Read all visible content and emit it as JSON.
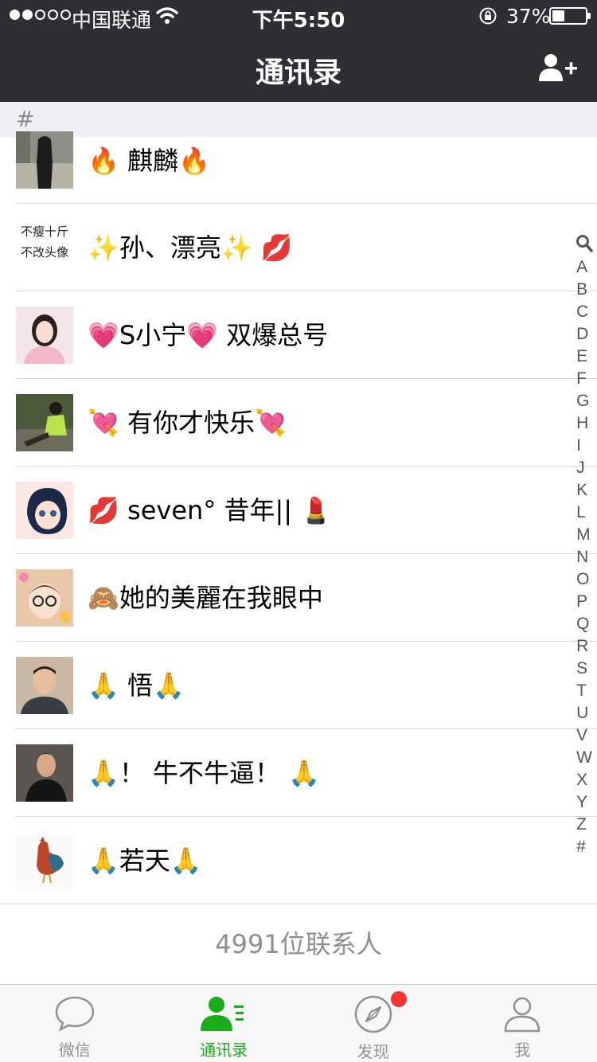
{
  "status": {
    "carrier": "中国联通",
    "time": "下午5:50",
    "battery": "37%",
    "battery_level": 0.37
  },
  "nav": {
    "title": "通讯录"
  },
  "section": {
    "letter": "#"
  },
  "contacts": [
    {
      "name": "🔥 麒麟🔥"
    },
    {
      "name": "✨孙、漂亮✨ 💋",
      "avatar_text": [
        "不瘦十斤",
        "不改头像"
      ]
    },
    {
      "name": "💗S小宁💗 双爆总号"
    },
    {
      "name": "💘 有你才快乐💘"
    },
    {
      "name": "💋 seven° 昔年|| 💄"
    },
    {
      "name": "🙈她的美麗在我眼中"
    },
    {
      "name": "🙏 悟🙏"
    },
    {
      "name": "🙏！ 牛不牛逼！ 🙏"
    },
    {
      "name": "🙏若天🙏"
    }
  ],
  "footer": {
    "count_text": "4991位联系人"
  },
  "index": [
    "A",
    "B",
    "C",
    "D",
    "E",
    "F",
    "G",
    "H",
    "I",
    "J",
    "K",
    "L",
    "M",
    "N",
    "O",
    "P",
    "Q",
    "R",
    "S",
    "T",
    "U",
    "V",
    "W",
    "X",
    "Y",
    "Z",
    "#"
  ],
  "tabs": [
    {
      "label": "微信"
    },
    {
      "label": "通讯录"
    },
    {
      "label": "发现"
    },
    {
      "label": "我"
    }
  ],
  "colors": {
    "accent": "#1aad19",
    "navbar": "#2e2f33",
    "badge": "#f43530"
  }
}
